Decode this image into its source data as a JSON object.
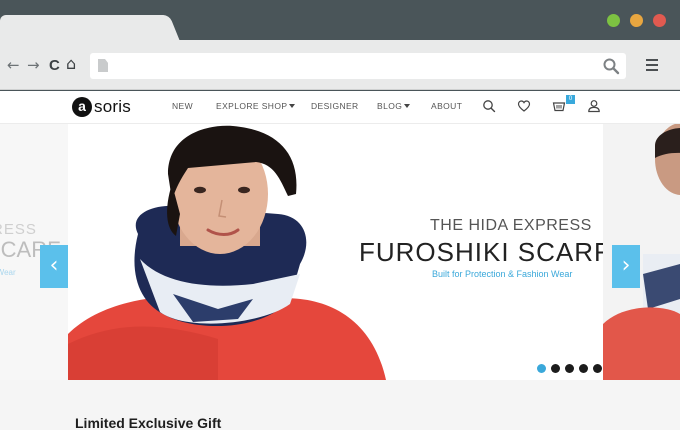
{
  "browser": {
    "back_glyph": "←",
    "forward_glyph": "→",
    "reload_glyph": "C",
    "home_glyph": "⌂",
    "address_value": "",
    "window_controls": [
      "#7dc242",
      "#e8a640",
      "#e15a50"
    ]
  },
  "site": {
    "logo_letter": "a",
    "logo_text": "soris",
    "nav": {
      "new": "NEW",
      "explore_shop": "EXPLORE SHOP",
      "designer": "DESIGNER",
      "blog": "BLOG",
      "about": "ABOUT"
    },
    "cart_count": "0",
    "icons": [
      "search-icon",
      "heart-icon",
      "cart-icon",
      "user-icon"
    ]
  },
  "hero": {
    "kicker": "THE HIDA EXPRESS",
    "title": "FUROSHIKI SCARF",
    "subtitle": "Built for Protection & Fashion Wear",
    "ghost_kicker": "RESS",
    "ghost_title": "SCARF",
    "ghost_subtitle": "n Wear",
    "prev_glyph": "‹",
    "next_glyph": "›",
    "slide_count": 5,
    "active_slide": 1,
    "accent_color": "#5bc0eb"
  },
  "section": {
    "title": "Limited Exclusive Gift"
  }
}
